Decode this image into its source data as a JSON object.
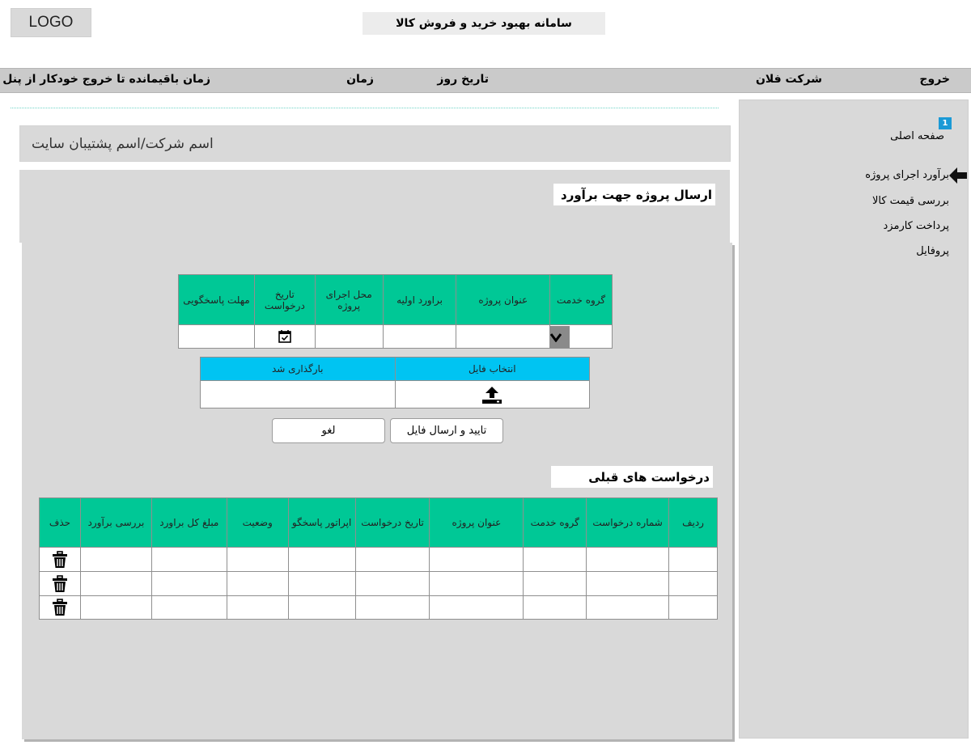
{
  "header": {
    "logo": "LOGO",
    "app_title": "سامانه بهبود خرید و فروش کالا"
  },
  "topbar": {
    "exit": "خروج",
    "company": "شرکت فلان",
    "date": "تاریخ روز",
    "time": "زمان",
    "remaining": "زمان باقیمانده تا خروج خودکار از پنل"
  },
  "sidebar": {
    "badge": "1",
    "items": [
      {
        "label": "صفحه اصلی"
      },
      {
        "label": "برآورد اجرای پروژه"
      },
      {
        "label": "بررسی قیمت کالا"
      },
      {
        "label": "پرداخت کارمزد"
      },
      {
        "label": "پروفایل"
      }
    ]
  },
  "company_bar": "اسم شرکت/اسم پشتیبان سایت",
  "send_section": {
    "title": "ارسال پروژه جهت برآورد",
    "columns": [
      "گروه خدمت",
      "عنوان پروژه",
      "براورد اولیه",
      "محل اجرای پروژه",
      "تاریخ درخواست",
      "مهلت پاسخگویی"
    ]
  },
  "upload": {
    "columns": [
      "انتخاب فایل",
      "بارگذاری شد"
    ]
  },
  "buttons": {
    "confirm": "تایید و ارسال فایل",
    "cancel": "لغو"
  },
  "previous": {
    "title": "درخواست های قبلی",
    "columns": [
      "ردیف",
      "شماره درخواست",
      "گروه خدمت",
      "عنوان پروژه",
      "تاریخ درخواست",
      "اپراتور پاسخگو",
      "وضعیت",
      "مبلغ کل براورد",
      "بررسی برآورد",
      "حذف"
    ]
  },
  "icons": {
    "back_arrow": "arrow-left-icon",
    "dropdown": "chevron-down-icon",
    "calendar": "calendar-icon",
    "upload": "upload-icon",
    "delete": "trash-icon"
  },
  "colors": {
    "table_header": "#00c896",
    "upload_header": "#00c4f2",
    "badge": "#1b9ad6",
    "panel": "#d9d9d9"
  }
}
